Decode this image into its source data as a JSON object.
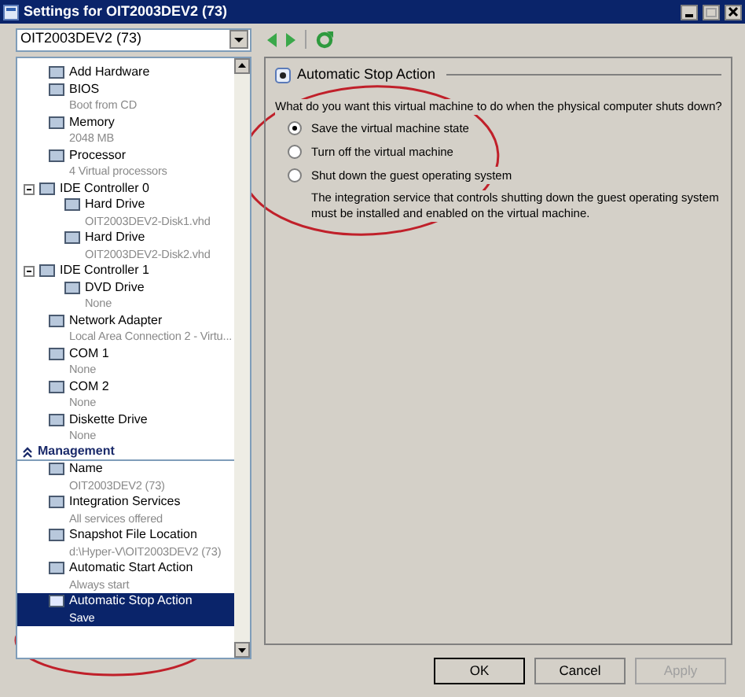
{
  "window": {
    "title": "Settings for OIT2003DEV2 (73)"
  },
  "vm_selector": {
    "value": "OIT2003DEV2 (73)"
  },
  "tree": [
    {
      "kind": "item",
      "label": "Add Hardware",
      "selected": false
    },
    {
      "kind": "item",
      "label": "BIOS",
      "detail": "Boot from CD",
      "selected": false
    },
    {
      "kind": "item",
      "label": "Memory",
      "detail": "2048 MB",
      "selected": false
    },
    {
      "kind": "item",
      "label": "Processor",
      "detail": "4 Virtual processors",
      "selected": false
    },
    {
      "kind": "group",
      "label": "IDE Controller 0",
      "expanded": true,
      "selected": false,
      "children": [
        {
          "kind": "item",
          "label": "Hard Drive",
          "detail": "OIT2003DEV2-Disk1.vhd",
          "selected": false
        },
        {
          "kind": "item",
          "label": "Hard Drive",
          "detail": "OIT2003DEV2-Disk2.vhd",
          "selected": false
        }
      ]
    },
    {
      "kind": "group",
      "label": "IDE Controller 1",
      "expanded": true,
      "selected": false,
      "children": [
        {
          "kind": "item",
          "label": "DVD Drive",
          "detail": "None",
          "selected": false
        }
      ]
    },
    {
      "kind": "item",
      "label": "Network Adapter",
      "detail": "Local Area Connection 2 - Virtu...",
      "selected": false
    },
    {
      "kind": "item",
      "label": "COM 1",
      "detail": "None",
      "selected": false
    },
    {
      "kind": "item",
      "label": "COM 2",
      "detail": "None",
      "selected": false
    },
    {
      "kind": "item",
      "label": "Diskette Drive",
      "detail": "None",
      "selected": false
    },
    {
      "kind": "header",
      "label": "Management",
      "expanded": true
    },
    {
      "kind": "item",
      "label": "Name",
      "detail": "OIT2003DEV2 (73)",
      "selected": false
    },
    {
      "kind": "item",
      "label": "Integration Services",
      "detail": "All services offered",
      "selected": false
    },
    {
      "kind": "item",
      "label": "Snapshot File Location",
      "detail": "d:\\Hyper-V\\OIT2003DEV2 (73)",
      "selected": false
    },
    {
      "kind": "item",
      "label": "Automatic Start Action",
      "detail": "Always start",
      "selected": false
    },
    {
      "kind": "item",
      "label": "Automatic Stop Action",
      "detail": "Save",
      "selected": true
    }
  ],
  "panel": {
    "title": "Automatic Stop Action",
    "question": "What do you want this virtual machine to do when the physical computer shuts down?",
    "options": [
      {
        "label": "Save the virtual machine state",
        "selected": true
      },
      {
        "label": "Turn off the virtual machine",
        "selected": false
      },
      {
        "label": "Shut down the guest operating system",
        "selected": false
      }
    ],
    "note": "The integration service that controls shutting down the guest operating system must be installed and enabled on the virtual machine."
  },
  "buttons": [
    {
      "label": "OK",
      "disabled": false
    },
    {
      "label": "Cancel",
      "disabled": false
    },
    {
      "label": "Apply",
      "disabled": true
    }
  ]
}
